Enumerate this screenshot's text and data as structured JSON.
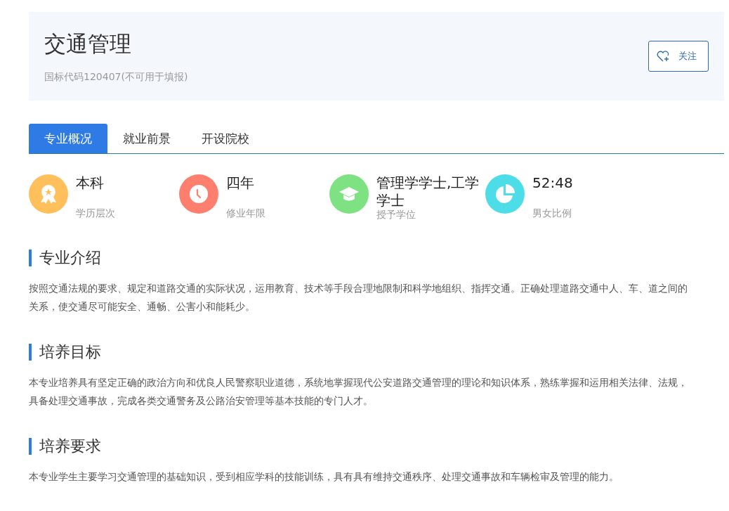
{
  "header": {
    "title": "交通管理",
    "subtitle": "国标代码120407(不可用于填报)",
    "follow_button": "关注"
  },
  "tabs": [
    {
      "label": "专业概况",
      "selected": true
    },
    {
      "label": "就业前景",
      "selected": false
    },
    {
      "label": "开设院校",
      "selected": false
    }
  ],
  "stats": [
    {
      "kind": "award",
      "color": "#ffc05c",
      "value": "本科",
      "label": "学历层次"
    },
    {
      "kind": "clock",
      "color": "#fe7f6d",
      "value": "四年",
      "label": "修业年限"
    },
    {
      "kind": "cap",
      "color": "#7ee282",
      "value": "管理学学士,工学学士",
      "label": "授予学位"
    },
    {
      "kind": "pie",
      "color": "#4ddde8",
      "value": "52:48",
      "label": "男女比例"
    }
  ],
  "sections": [
    {
      "heading": "专业介绍",
      "text": "按照交通法规的要求、规定和道路交通的实际状况，运用教育、技术等手段合理地限制和科学地组织、指挥交通。正确处理道路交通中人、车、道之间的关系，使交通尽可能安全、通畅、公害小和能耗少。"
    },
    {
      "heading": "培养目标",
      "text": "本专业培养具有坚定正确的政治方向和优良人民警察职业道德，系统地掌握现代公安道路交通管理的理论和知识体系，熟练掌握和运用相关法律、法规，具备处理交通事故，完成各类交通警务及公路治安管理等基本技能的专门人才。"
    },
    {
      "heading": "培养要求",
      "text": "本专业学生主要学习交通管理的基础知识，受到相应学科的技能训练，具有具有维持交通秩序、处理交通事故和车辆检审及管理的能力。"
    }
  ]
}
